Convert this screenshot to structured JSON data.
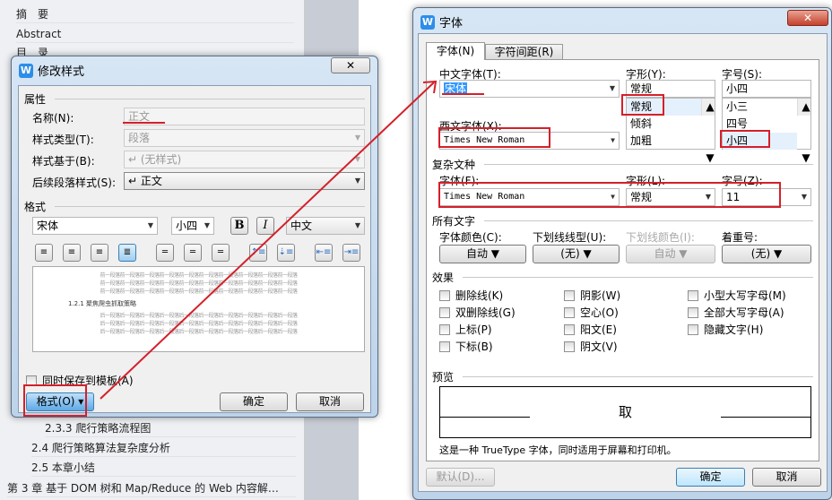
{
  "nav": {
    "items": [
      "摘　要",
      "Abstract",
      "目　录"
    ],
    "bottom_items": [
      "2.3.3  爬行策略流程图",
      "2.4  爬行策略算法复杂度分析",
      "2.5  本章小结",
      "第 3 章  基于 DOM 树和 Map/Reduce 的 Web 内容解…"
    ]
  },
  "modify_style": {
    "title": "修改样式",
    "close": "✕",
    "section_props": "属性",
    "name_label": "名称(N):",
    "name_value": "正文",
    "type_label": "样式类型(T):",
    "type_value": "段落",
    "based_label": "样式基于(B):",
    "based_value": "↵ (无样式)",
    "next_label": "后续段落样式(S):",
    "next_value": "↵ 正文",
    "section_format": "格式",
    "font": "宋体",
    "size": "小四",
    "bold": "B",
    "italic": "I",
    "script": "中文",
    "preview_before": "前一段落前一段落前一段落前一段落前一段落前一段落前一段落前一段落前一段落前一段落",
    "preview_heading": "1.2.1  聚焦爬虫抓取策略",
    "preview_after": "后一段落后一段落后一段落后一段落后一段落后一段落后一段落后一段落后一段落后一段落",
    "save_template": "同时保存到模板(A)",
    "format_button": "格式(O) ▾",
    "ok": "确定",
    "cancel": "取消"
  },
  "font_dialog": {
    "title": "字体",
    "close": "✕",
    "tabs": [
      "字体(N)",
      "字符间距(R)"
    ],
    "cn_font_label": "中文字体(T):",
    "cn_font": "宋体",
    "style_label": "字形(Y):",
    "style": "常规",
    "style_list": [
      "常规",
      "倾斜",
      "加粗"
    ],
    "size_label": "字号(S):",
    "size": "小四",
    "size_list": [
      "小三",
      "四号",
      "小四"
    ],
    "west_font_label": "西文字体(X):",
    "west_font": "Times New Roman",
    "complex_section": "复杂文种",
    "cx_font_label": "字体(F):",
    "cx_font": "Times New Roman",
    "cx_style_label": "字形(L):",
    "cx_style": "常规",
    "cx_size_label": "字号(Z):",
    "cx_size": "11",
    "all_section": "所有文字",
    "color_label": "字体颜色(C):",
    "color": "自动",
    "uline_label": "下划线线型(U):",
    "uline": "(无)",
    "ucolor_label": "下划线颜色(I):",
    "ucolor": "自动",
    "emph_label": "着重号:",
    "emph": "(无)",
    "effects_section": "效果",
    "effects": [
      [
        "删除线(K)",
        "双删除线(G)",
        "上标(P)",
        "下标(B)"
      ],
      [
        "阴影(W)",
        "空心(O)",
        "阳文(E)",
        "阴文(V)"
      ],
      [
        "小型大写字母(M)",
        "全部大写字母(A)",
        "隐藏文字(H)"
      ]
    ],
    "preview_section": "预览",
    "preview_char": "取",
    "preview_caption": "这是一种 TrueType 字体，同时适用于屏幕和打印机。",
    "default": "默认(D)...",
    "ok": "确定",
    "cancel": "取消"
  },
  "colors": {
    "annotation": "#d4202a",
    "accent": "#2c8ee8"
  }
}
